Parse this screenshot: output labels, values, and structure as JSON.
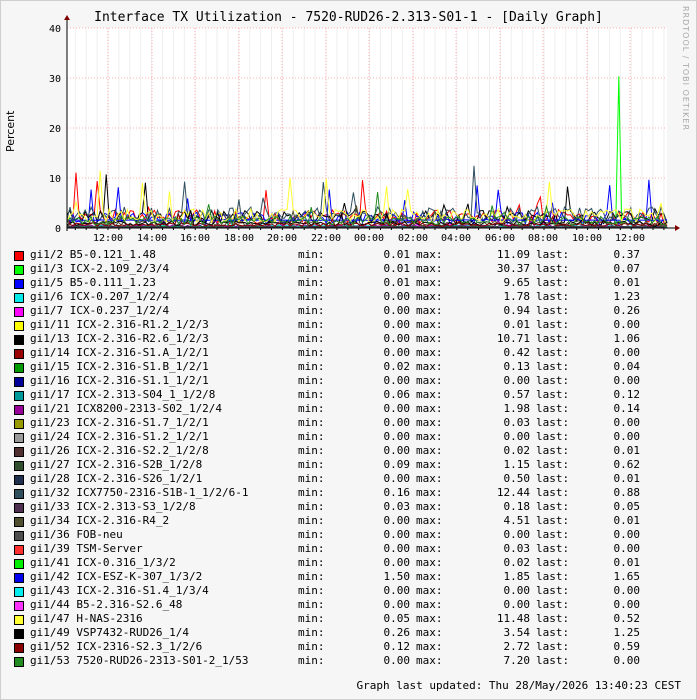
{
  "chart_data": {
    "type": "line",
    "title": "Interface TX Utilization - 7520-RUD26-2.313-S01-1 - [Daily Graph]",
    "ylabel": "Percent",
    "ylim": [
      0,
      40
    ],
    "yticks": [
      0,
      10,
      20,
      30,
      40
    ],
    "xticks": [
      "12:00",
      "14:00",
      "16:00",
      "18:00",
      "20:00",
      "22:00",
      "00:00",
      "02:00",
      "04:00",
      "06:00",
      "08:00",
      "10:00",
      "12:00"
    ],
    "grid": true,
    "watermark": "RRDTOOL / TOBI OETIKER",
    "stat_labels": {
      "min": "min:",
      "max": "max:",
      "last": "last:"
    },
    "series": [
      {
        "name": "gi1/2 B5-0.121_1.48",
        "color": "#ff0000",
        "min": "0.01",
        "max": "11.09",
        "last": "0.37"
      },
      {
        "name": "gi1/3 ICX-2.109_2/3/4",
        "color": "#00ff00",
        "min": "0.01",
        "max": "30.37",
        "last": "0.07"
      },
      {
        "name": "gi1/5 B5-0.111_1.23",
        "color": "#0000ff",
        "min": "0.01",
        "max": "9.65",
        "last": "0.01"
      },
      {
        "name": "gi1/6 ICX-0.207_1/2/4",
        "color": "#00e8e8",
        "min": "0.00",
        "max": "1.78",
        "last": "1.23"
      },
      {
        "name": "gi1/7 ICX-0.237_1/2/4",
        "color": "#ff00ff",
        "min": "0.00",
        "max": "0.94",
        "last": "0.26"
      },
      {
        "name": "gi1/11 ICX-2.316-R1.2_1/2/3",
        "color": "#ffff00",
        "min": "0.00",
        "max": "0.01",
        "last": "0.00"
      },
      {
        "name": "gi1/13 ICX-2.316-R2.6_1/2/3",
        "color": "#000000",
        "min": "0.00",
        "max": "10.71",
        "last": "1.06"
      },
      {
        "name": "gi1/14 ICX-2.316-S1.A_1/2/1",
        "color": "#990000",
        "min": "0.00",
        "max": "0.42",
        "last": "0.00"
      },
      {
        "name": "gi1/15 ICX-2.316-S1.B_1/2/1",
        "color": "#009900",
        "min": "0.02",
        "max": "0.13",
        "last": "0.04"
      },
      {
        "name": "gi1/16 ICX-2.316-S1.1_1/2/1",
        "color": "#000099",
        "min": "0.00",
        "max": "0.00",
        "last": "0.00"
      },
      {
        "name": "gi1/17 ICX-2.313-S04_1_1/2/8",
        "color": "#009999",
        "min": "0.06",
        "max": "0.57",
        "last": "0.12"
      },
      {
        "name": "gi1/21 ICX8200-2313-S02_1/2/4",
        "color": "#990099",
        "min": "0.00",
        "max": "1.98",
        "last": "0.14"
      },
      {
        "name": "gi1/23 ICX-2.316-S1.7_1/2/1",
        "color": "#999900",
        "min": "0.00",
        "max": "0.03",
        "last": "0.00"
      },
      {
        "name": "gi1/24 ICX-2.316-S1.2_1/2/1",
        "color": "#999999",
        "min": "0.00",
        "max": "0.00",
        "last": "0.00"
      },
      {
        "name": "gi1/26 ICX-2.316-S2.2_1/2/8",
        "color": "#4f2f2f",
        "min": "0.00",
        "max": "0.02",
        "last": "0.01"
      },
      {
        "name": "gi1/27 ICX-2.316-S2B_1/2/8",
        "color": "#2f4f2f",
        "min": "0.09",
        "max": "1.15",
        "last": "0.62"
      },
      {
        "name": "gi1/28 ICX-2.316-S26_1/2/1",
        "color": "#1f2f4f",
        "min": "0.00",
        "max": "0.50",
        "last": "0.01"
      },
      {
        "name": "gi1/32 ICX7750-2316-S1B-1_1/2/6-1",
        "color": "#2f4f5f",
        "min": "0.16",
        "max": "12.44",
        "last": "0.88"
      },
      {
        "name": "gi1/33 ICX-2.313-S3_1/2/8",
        "color": "#4f2f4f",
        "min": "0.03",
        "max": "0.18",
        "last": "0.05"
      },
      {
        "name": "gi1/34 ICX-2.316-R4_2",
        "color": "#4f4f2f",
        "min": "0.00",
        "max": "4.51",
        "last": "0.01"
      },
      {
        "name": "gi1/36 FOB-neu",
        "color": "#4f4f4f",
        "min": "0.00",
        "max": "0.00",
        "last": "0.00"
      },
      {
        "name": "gi1/39 TSM-Server",
        "color": "#ff3030",
        "min": "0.00",
        "max": "0.03",
        "last": "0.00"
      },
      {
        "name": "gi1/41 ICX-0.316_1/3/2",
        "color": "#00ee00",
        "min": "0.00",
        "max": "0.02",
        "last": "0.01"
      },
      {
        "name": "gi1/42 ICX-ESZ-K-307_1/3/2",
        "color": "#0000ee",
        "min": "1.50",
        "max": "1.85",
        "last": "1.65"
      },
      {
        "name": "gi1/43 ICX-2.316-S1.4_1/3/4",
        "color": "#00eeee",
        "min": "0.00",
        "max": "0.00",
        "last": "0.00"
      },
      {
        "name": "gi1/44 B5-2.316-S2.6_48",
        "color": "#ff33ff",
        "min": "0.00",
        "max": "0.00",
        "last": "0.00"
      },
      {
        "name": "gi1/47 H-NAS-2316",
        "color": "#ffff33",
        "min": "0.05",
        "max": "11.48",
        "last": "0.52"
      },
      {
        "name": "gi1/49 VSP7432-RUD26_1/4",
        "color": "#000000",
        "min": "0.26",
        "max": "3.54",
        "last": "1.25"
      },
      {
        "name": "gi1/52 ICX-2316-S2.3_1/2/6",
        "color": "#8b0000",
        "min": "0.12",
        "max": "2.72",
        "last": "0.59"
      },
      {
        "name": "gi1/53 7520-RUD26-2313-S01-2_1/53",
        "color": "#228b22",
        "min": "0.00",
        "max": "7.20",
        "last": "0.00"
      }
    ]
  },
  "footer": {
    "last_updated": "Graph last updated: Thu 28/May/2026 13:40:23 CEST"
  }
}
